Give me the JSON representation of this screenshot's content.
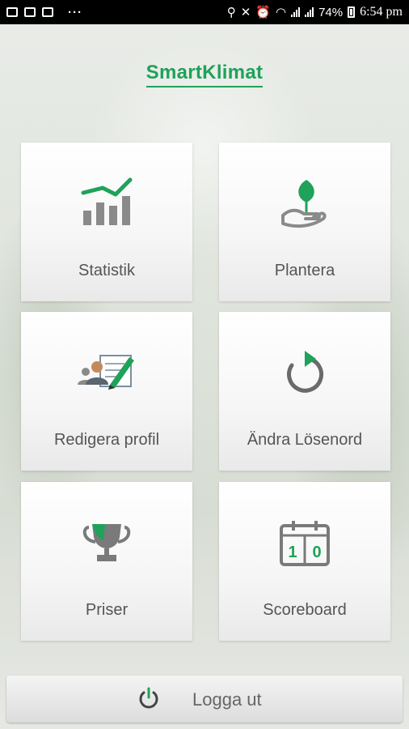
{
  "status_bar": {
    "more": "···",
    "battery": "74%",
    "time": "6:54 pm"
  },
  "app": {
    "title": "SmartKlimat",
    "accent_color": "#1fa25a"
  },
  "tiles": [
    {
      "label": "Statistik",
      "icon": "chart-trend-icon"
    },
    {
      "label": "Plantera",
      "icon": "plant-hand-icon"
    },
    {
      "label": "Redigera profil",
      "icon": "edit-profile-icon"
    },
    {
      "label": "Ändra Lösenord",
      "icon": "refresh-icon"
    },
    {
      "label": "Priser",
      "icon": "trophy-icon"
    },
    {
      "label": "Scoreboard",
      "icon": "scoreboard-icon"
    }
  ],
  "scoreboard_digits": [
    "1",
    "0"
  ],
  "logout": {
    "label": "Logga ut",
    "icon": "power-icon"
  }
}
